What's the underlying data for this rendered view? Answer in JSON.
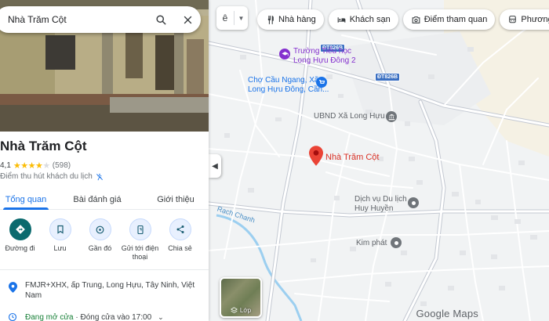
{
  "search": {
    "query": "Nhà Trăm Cột"
  },
  "place": {
    "name": "Nhà Trăm Cột",
    "rating": "4,1",
    "stars": 4,
    "review_count": "(598)",
    "category": "Điểm thu hút khách du lịch"
  },
  "tabs": [
    {
      "label": "Tổng quan",
      "active": true
    },
    {
      "label": "Bài đánh giá",
      "active": false
    },
    {
      "label": "Giới thiệu",
      "active": false
    }
  ],
  "actions": [
    {
      "label": "Đường đi",
      "icon": "directions-icon"
    },
    {
      "label": "Lưu",
      "icon": "bookmark-icon"
    },
    {
      "label": "Gần đó",
      "icon": "nearby-icon"
    },
    {
      "label": "Gửi tới điện thoại",
      "icon": "phone-icon"
    },
    {
      "label": "Chia sẻ",
      "icon": "share-icon"
    }
  ],
  "details": {
    "address": "FMJR+XHX, ấp Trung, Long Hựu, Tây Ninh, Việt Nam",
    "hours_status": "Đang mở cửa",
    "hours_detail": "· Đóng cửa vào 17:00"
  },
  "map": {
    "language_button": "ê",
    "chips": [
      {
        "label": "Nhà hàng",
        "icon": "restaurant-icon"
      },
      {
        "label": "Khách sạn",
        "icon": "hotel-icon"
      },
      {
        "label": "Điểm tham quan",
        "icon": "camera-icon"
      },
      {
        "label": "Phương tiện công",
        "icon": "transit-icon"
      }
    ],
    "labels": {
      "school": "Trường Tiểu học\nLong Hựu Đông 2",
      "market": "Chợ Cầu Ngang, Xã\nLong Hựu Đông, Cần...",
      "ubnd": "UBND Xã Long Hựu",
      "pin": "Nhà Trăm Cột",
      "tourism": "Dịch vụ Du lịch\nHuy Huyền",
      "kimphat": "Kim phát",
      "river": "Rạch Chanh"
    },
    "road_shield_1": "ĐT826B",
    "road_shield_2": "ĐT826B",
    "layers_label": "Lớp",
    "logo": "Google Maps",
    "colors": {
      "pin": "#ea4335",
      "water": "#9ccff0",
      "purple_poi": "#8430ce",
      "blue_poi": "#1a73e8",
      "grey_poi": "#70757a"
    }
  }
}
